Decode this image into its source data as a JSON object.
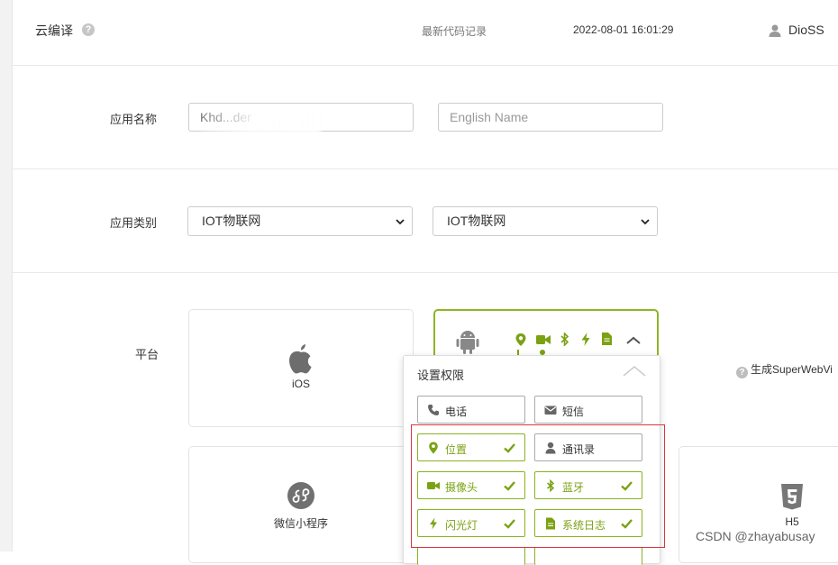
{
  "header": {
    "title": "云编译",
    "latest_record_label": "最新代码记录",
    "datetime": "2022-08-01 16:01:29",
    "user": "DioSS"
  },
  "form": {
    "app_name": {
      "label": "应用名称",
      "value": "Khd...der",
      "english_placeholder": "English Name"
    },
    "app_category": {
      "label": "应用类别",
      "primary_value": "IOT物联网",
      "secondary_value": "IOT物联网"
    },
    "platform": {
      "label": "平台",
      "cards": [
        {
          "label": "iOS",
          "icon": "apple-icon"
        },
        {
          "label": "微信小程序",
          "icon": "wechat-miniprogram-icon"
        },
        {
          "label": "H5",
          "icon": "html5-icon"
        }
      ],
      "android_icon": "android-icon",
      "superwebview_label": "生成SuperWebVi"
    }
  },
  "permissions": {
    "title": "设置权限",
    "items": [
      {
        "label": "电话",
        "icon": "phone-icon",
        "active": false
      },
      {
        "label": "短信",
        "icon": "envelope-icon",
        "active": false
      },
      {
        "label": "位置",
        "icon": "location-icon",
        "active": true
      },
      {
        "label": "通讯录",
        "icon": "contacts-icon",
        "active": false
      },
      {
        "label": "摄像头",
        "icon": "camera-icon",
        "active": true
      },
      {
        "label": "蓝牙",
        "icon": "bluetooth-icon",
        "active": true
      },
      {
        "label": "闪光灯",
        "icon": "flash-icon",
        "active": true
      },
      {
        "label": "系统日志",
        "icon": "file-icon",
        "active": true
      }
    ]
  },
  "colors": {
    "accent_green": "#8ab21e",
    "highlight_red": "#d9363e"
  },
  "watermark": "CSDN @zhayabusay"
}
